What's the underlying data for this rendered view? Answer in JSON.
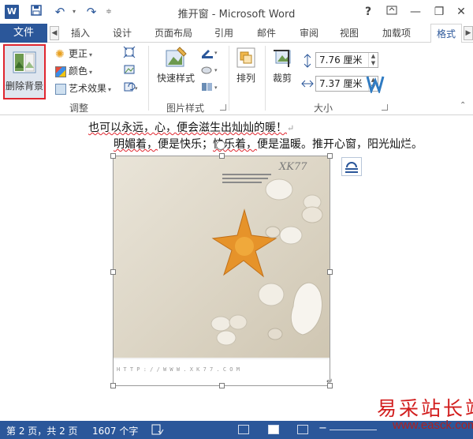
{
  "app": {
    "title": "推开窗 - Microsoft Word",
    "logo_letter": "W"
  },
  "title_controls": {
    "help": "?",
    "minimize": "—",
    "restore": "❐",
    "close": "✕"
  },
  "tabs": [
    {
      "label": "文件"
    },
    {
      "label": "插入"
    },
    {
      "label": "设计"
    },
    {
      "label": "页面布局"
    },
    {
      "label": "引用"
    },
    {
      "label": "邮件"
    },
    {
      "label": "审阅"
    },
    {
      "label": "视图"
    },
    {
      "label": "加载项"
    },
    {
      "label": "格式"
    }
  ],
  "ribbon": {
    "remove_bg_label": "删除背景",
    "corrections_label": "更正",
    "color_label": "颜色",
    "artistic_label": "艺术效果",
    "group_adjust": "调整",
    "quick_styles_label": "快速样式",
    "group_picture_styles": "图片样式",
    "arrange_label": "排列",
    "crop_label": "裁剪",
    "height_value": "7.76 厘米",
    "width_value": "7.37 厘米",
    "group_size": "大小"
  },
  "document": {
    "line1": "也可以永远，心，便会滋生出灿灿的暖！",
    "line2_a": "明媚着，",
    "line2_b": "便是快乐；",
    "line2_c": "快乐着，",
    "line2_d": "便是温暖。推开心窗，阳光灿烂。",
    "paragraph_mark": "↵",
    "image_watermark": "XK77",
    "image_url_text": "H T T P : / / W W W . X K 7 7 . C O M"
  },
  "statusbar": {
    "page": "第 2 页，共 2 页",
    "words": "1607 个字"
  },
  "watermark": {
    "text": "易采站长站",
    "url": "www.easck.com"
  },
  "colors": {
    "accent": "#2b579a",
    "highlight_border": "#e0262f"
  }
}
